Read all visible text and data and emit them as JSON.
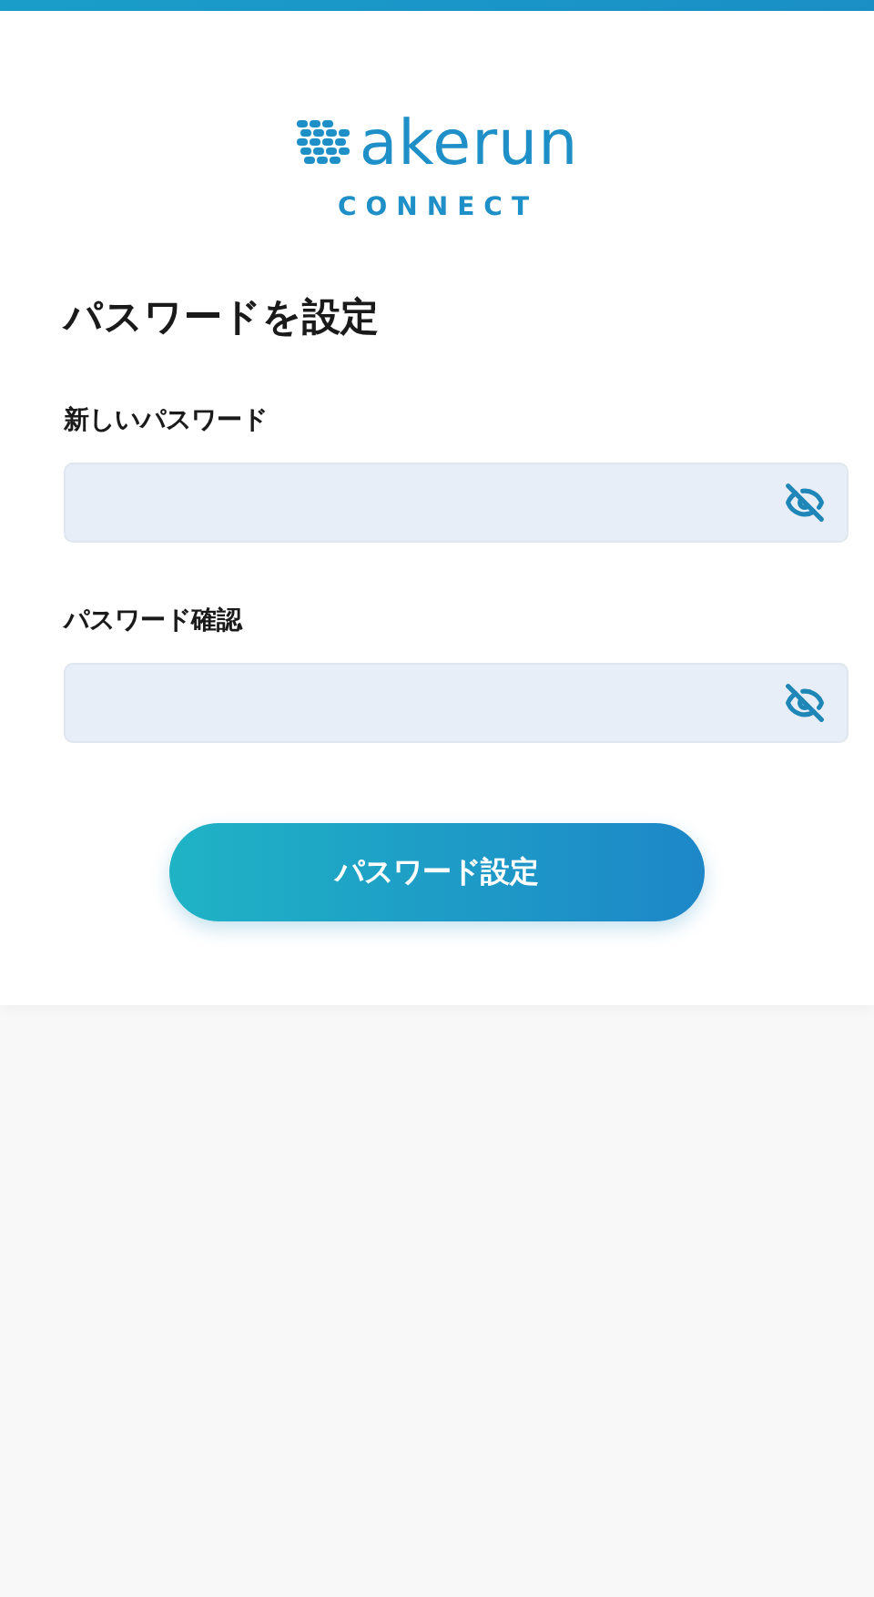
{
  "logo": {
    "wordmark": "akerun",
    "subtitle": "CONNECT"
  },
  "heading": "パスワードを設定",
  "fields": [
    {
      "label": "新しいパスワード"
    },
    {
      "label": "パスワード確認"
    }
  ],
  "submit_button": "パスワード設定"
}
